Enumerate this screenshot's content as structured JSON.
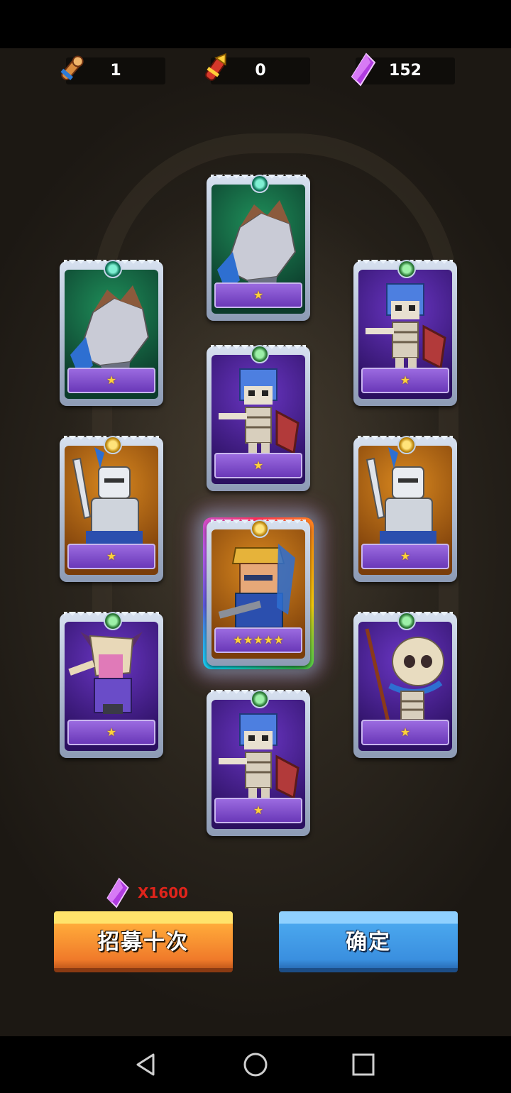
{
  "resources": [
    {
      "name": "scroll",
      "value": "1"
    },
    {
      "name": "torch-scroll",
      "value": "0"
    },
    {
      "name": "crystal",
      "value": "152"
    }
  ],
  "cards": [
    {
      "id": "c1",
      "type": "rock-golem",
      "bg": "green",
      "gem": "teal",
      "stars": "★"
    },
    {
      "id": "c2",
      "type": "rock-golem",
      "bg": "green",
      "gem": "teal",
      "stars": "★"
    },
    {
      "id": "c3",
      "type": "skeleton-knight",
      "bg": "purple",
      "gem": "green",
      "stars": "★"
    },
    {
      "id": "c4",
      "type": "skeleton-knight",
      "bg": "purple",
      "gem": "green",
      "stars": "★"
    },
    {
      "id": "c5",
      "type": "armored-knight",
      "bg": "orange",
      "gem": "gold",
      "stars": "★"
    },
    {
      "id": "c6",
      "type": "armored-knight",
      "bg": "orange",
      "gem": "gold",
      "stars": "★"
    },
    {
      "id": "c7",
      "type": "hero-warrior",
      "bg": "orange",
      "gem": "gold",
      "stars": "★★★★★"
    },
    {
      "id": "c8",
      "type": "horned-warrior",
      "bg": "purple",
      "gem": "green",
      "stars": "★"
    },
    {
      "id": "c9",
      "type": "skeleton-mage",
      "bg": "purple",
      "gem": "green",
      "stars": "★"
    },
    {
      "id": "c10",
      "type": "skeleton-knight",
      "bg": "purple",
      "gem": "green",
      "stars": "★"
    }
  ],
  "cost": {
    "value": "X1600"
  },
  "buttons": {
    "recruit": "招募十次",
    "confirm": "确定"
  },
  "colors": {
    "accent_orange": "#f07a2a",
    "accent_blue": "#3a8fdf",
    "cost_red": "#e0241b"
  }
}
